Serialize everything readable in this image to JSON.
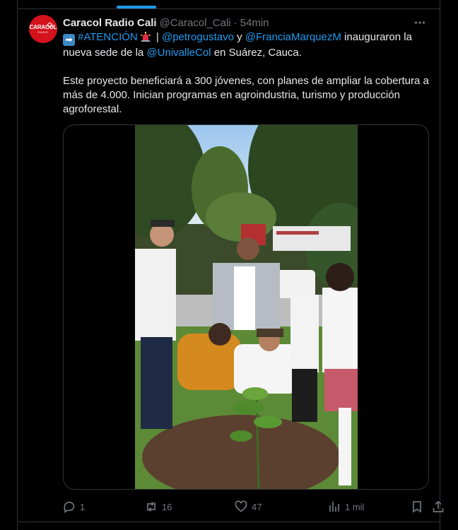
{
  "tweet": {
    "display_name": "Caracol Radio Cali",
    "handle": "@Caracol_Cali",
    "separator": "·",
    "time": "54min",
    "more_icon": "more-horizontal-icon",
    "avatar": {
      "text_main": "CARACOL",
      "text_sub": "RADIO",
      "color": "#d3121b"
    },
    "text": {
      "hashtag": "#ATENCIÓN",
      "pipe": " | ",
      "mention_petro": "@petrogustavo",
      "and": " y ",
      "mention_francia": "@FranciaMarquezM",
      "inaugurated": " inauguraron la nueva sede de la ",
      "mention_univalle": "@UnivalleCol",
      "location": " en Suárez, Cauca.",
      "paragraph2": "Este proyecto beneficiará a 300 jóvenes, con planes de ampliar la cobertura a más de 4.000. Inician programas en agroindustria, turismo y producción agroforestal."
    },
    "media": {
      "type": "video",
      "description_icon": "video-frame"
    },
    "actions": {
      "replies": "1",
      "reposts": "16",
      "likes": "47",
      "views": "1 mil"
    }
  },
  "colors": {
    "background": "#000000",
    "text": "#e7e9ea",
    "muted": "#71767b",
    "link": "#1d9bf0",
    "border": "#2f3336"
  }
}
